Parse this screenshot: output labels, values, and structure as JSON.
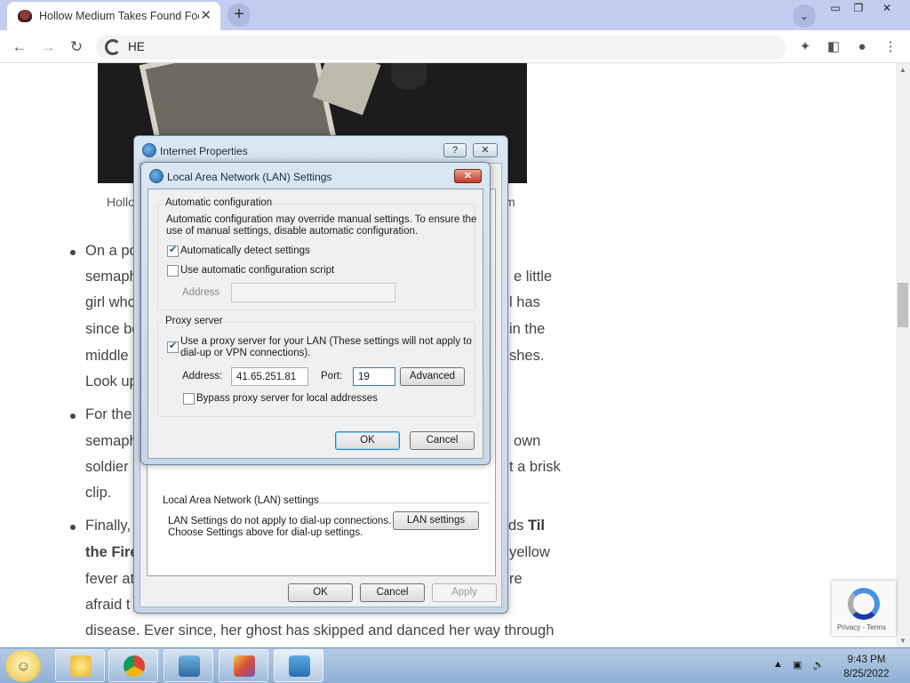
{
  "browser": {
    "tab_title": "Hollow Medium Takes Found Footage",
    "tab_close": "✕",
    "new_tab": "+",
    "tab_search": "⌄",
    "address_text": "HE",
    "window_buttons": {
      "minimize": "▭",
      "restore": "❐",
      "close": "✕"
    },
    "toolbar_icons": {
      "back": "←",
      "forward": "→",
      "reload": "↻",
      "extensions": "✦",
      "side_panel": "◧",
      "profile": "●",
      "menu": "⋮"
    }
  },
  "page": {
    "caption_left": "Hollo",
    "caption_right": "m",
    "lines": {
      "l1": "On a po",
      "l2a": "semaph",
      "l2b": "e little",
      "l3a": "girl who",
      "l3b": "l has",
      "l4a": "since be",
      "l4b": "in the",
      "l5a": "middle",
      "l5b": "shes.",
      "l6": "Look up",
      "l7": "For the",
      "l8a": "semaph",
      "l8b": "own",
      "l9a": "soldier",
      "l9b": "t a brisk",
      "l10": "clip.",
      "l11a": "Finally,",
      "l11b": "ds ",
      "l11b_bold": "Til",
      "l12a_bold": "the Fire",
      "l12b": "yellow",
      "l13a": "fever at",
      "l13b": "re",
      "l14": "afraid t",
      "l15": "disease. Ever since, her ghost has skipped and danced her way through"
    },
    "recaptcha_links": "Privacy - Terms"
  },
  "internet_properties": {
    "title": "Internet Properties",
    "help_btn": "?",
    "close_btn": "✕",
    "lan_group_label": "Local Area Network (LAN) settings",
    "lan_note": "LAN Settings do not apply to dial-up connections.",
    "lan_note2": "Choose Settings above for dial-up settings.",
    "lan_settings_btn": "LAN settings",
    "ok": "OK",
    "cancel": "Cancel",
    "apply": "Apply"
  },
  "lan_dialog": {
    "title": "Local Area Network (LAN) Settings",
    "close_btn": "✕",
    "auto_group": "Automatic configuration",
    "auto_desc1": "Automatic configuration may override manual settings.  To ensure the",
    "auto_desc2": "use of manual settings, disable automatic configuration.",
    "auto_detect": {
      "label": "Automatically detect settings",
      "checked": true
    },
    "auto_script": {
      "label": "Use automatic configuration script",
      "checked": false
    },
    "script_address_label": "Address",
    "script_address_value": "",
    "proxy_group": "Proxy server",
    "use_proxy": {
      "label1": "Use a proxy server for your LAN (These settings will not apply to",
      "label2": "dial-up or VPN connections).",
      "checked": true
    },
    "address_label": "Address:",
    "address_value": "41.65.251.81",
    "port_label": "Port:",
    "port_value": "19",
    "advanced_btn": "Advanced",
    "bypass": {
      "label": "Bypass proxy server for local addresses",
      "checked": false
    },
    "ok": "OK",
    "cancel": "Cancel"
  },
  "taskbar": {
    "time": "9:43 PM",
    "date": "8/25/2022",
    "tray_icons": {
      "arrow": "▲",
      "network": "▣",
      "volume": "🔈"
    },
    "apps": [
      "folders-icon",
      "chrome-icon",
      "photo-icon",
      "paint-icon",
      "control-panel-icon"
    ]
  }
}
